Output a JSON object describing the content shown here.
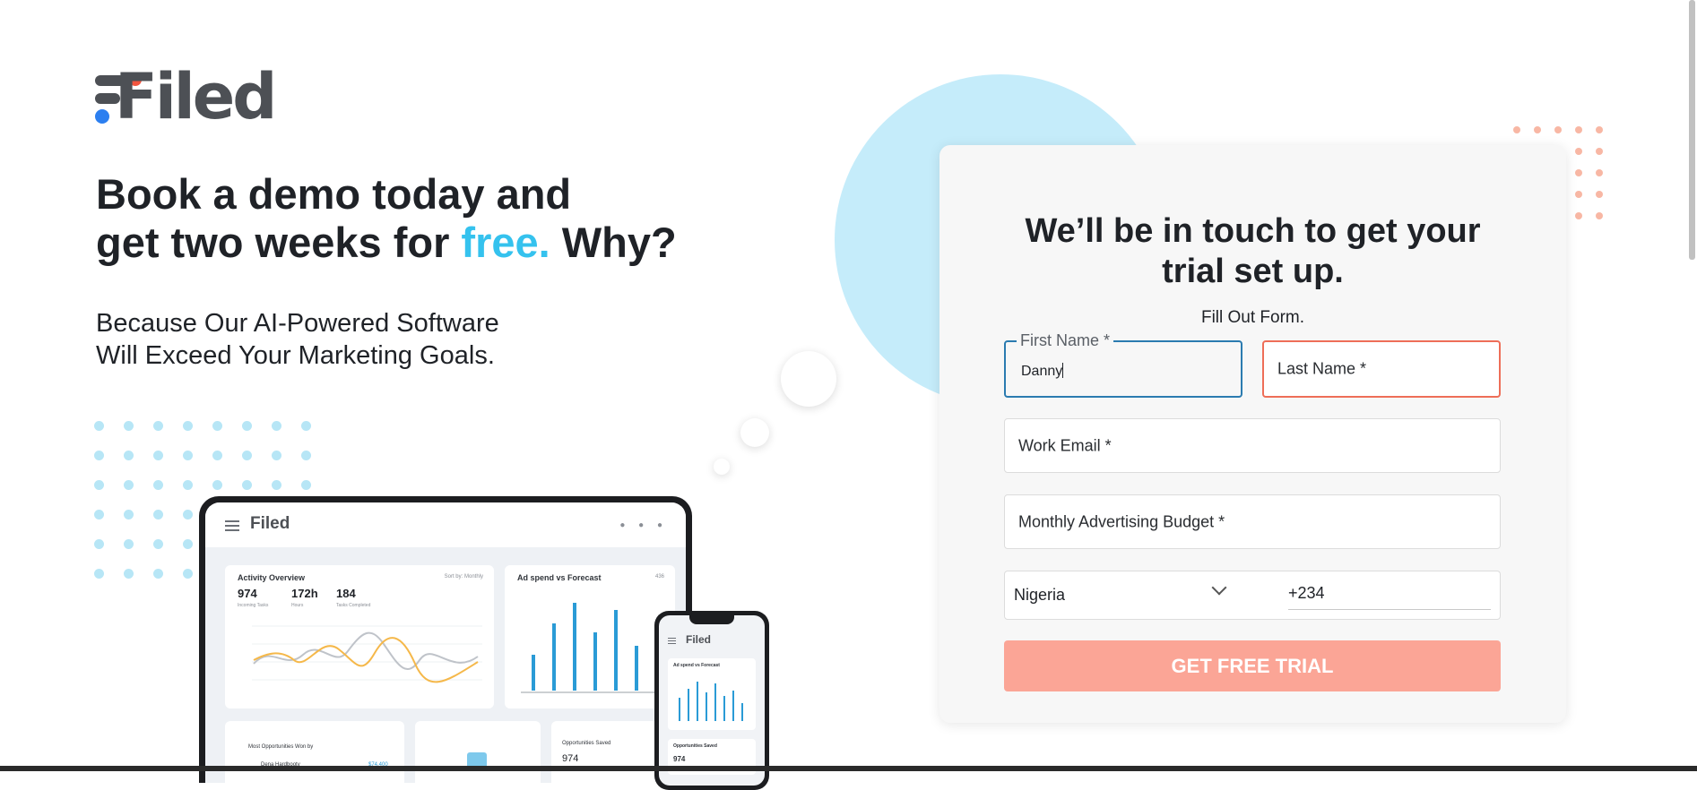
{
  "brand": {
    "logo_text": "Filed",
    "colors": {
      "accent_blue": "#35c2ee",
      "logo_red": "#f2553f",
      "logo_blue": "#2c7ff0",
      "cta": "#fba596",
      "focus_border": "#2b7bb0",
      "error_border": "#ee6e58"
    }
  },
  "hero": {
    "headline_line1": "Book a demo today and",
    "headline_line2_pre": "get two weeks for ",
    "headline_line2_accent": "free.",
    "headline_line2_post": " Why?",
    "subhead_line1": "Because Our AI-Powered Software",
    "subhead_line2": "Will Exceed Your Marketing Goals."
  },
  "mockup": {
    "laptop": {
      "logo": "Filed",
      "activity_title": "Activity Overview",
      "activity_sort": "Sort by: Monthly",
      "stats": [
        {
          "value": "974",
          "label": "Incoming Tasks"
        },
        {
          "value": "172h",
          "label": "Hours"
        },
        {
          "value": "184",
          "label": "Tasks Completed"
        }
      ],
      "adspend_title": "Ad spend vs Forecast",
      "adspend_badge": "436",
      "opportunities_title": "Most Opportunities Won by",
      "opportunities_person": "Dena Hardbooty",
      "opportunities_amount": "$74,400",
      "opp_saved_title": "Opportunities Saved",
      "opp_saved_value": "974"
    },
    "phone": {
      "logo": "Filed",
      "card_title": "Ad spend vs Forecast",
      "card2_title": "Opportunities Saved",
      "card2_value": "974"
    }
  },
  "form": {
    "heading_line1": "We’ll be in touch to get your",
    "heading_line2": "trial set up.",
    "subtitle": "Fill Out Form.",
    "first_name": {
      "label": "First Name *",
      "value": "Danny"
    },
    "last_name": {
      "placeholder": "Last Name *"
    },
    "work_email": {
      "placeholder": "Work Email *"
    },
    "budget": {
      "placeholder": "Monthly Advertising Budget *"
    },
    "country": {
      "selected": "Nigeria"
    },
    "dial_code": "+234",
    "submit_label": "GET FREE TRIAL"
  }
}
